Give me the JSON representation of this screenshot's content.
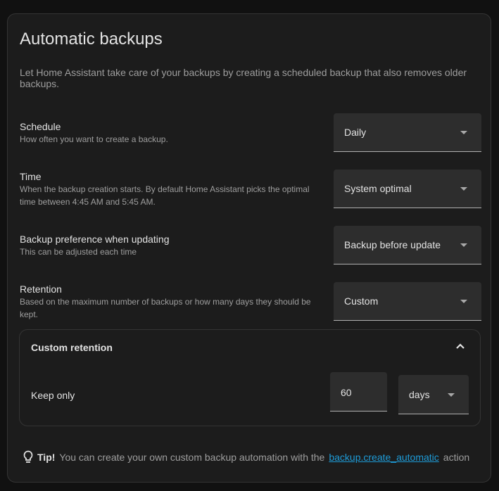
{
  "title": "Automatic backups",
  "description": "Let Home Assistant take care of your backups by creating a scheduled backup that also removes older backups.",
  "settings": [
    {
      "label": "Schedule",
      "sub": "How often you want to create a backup.",
      "value": "Daily"
    },
    {
      "label": "Time",
      "sub": "When the backup creation starts. By default Home Assistant picks the optimal time between 4:45 AM and 5:45 AM.",
      "value": "System optimal"
    },
    {
      "label": "Backup preference when updating",
      "sub": "This can be adjusted each time",
      "value": "Backup before update"
    },
    {
      "label": "Retention",
      "sub": "Based on the maximum number of backups or how many days they should be kept.",
      "value": "Custom"
    }
  ],
  "custom_retention": {
    "header": "Custom retention",
    "keep_label": "Keep only",
    "number": "60",
    "unit": "days"
  },
  "tip": {
    "label": "Tip!",
    "text": "You can create your own custom backup automation with the",
    "link": "backup.create_automatic",
    "suffix": "action"
  }
}
